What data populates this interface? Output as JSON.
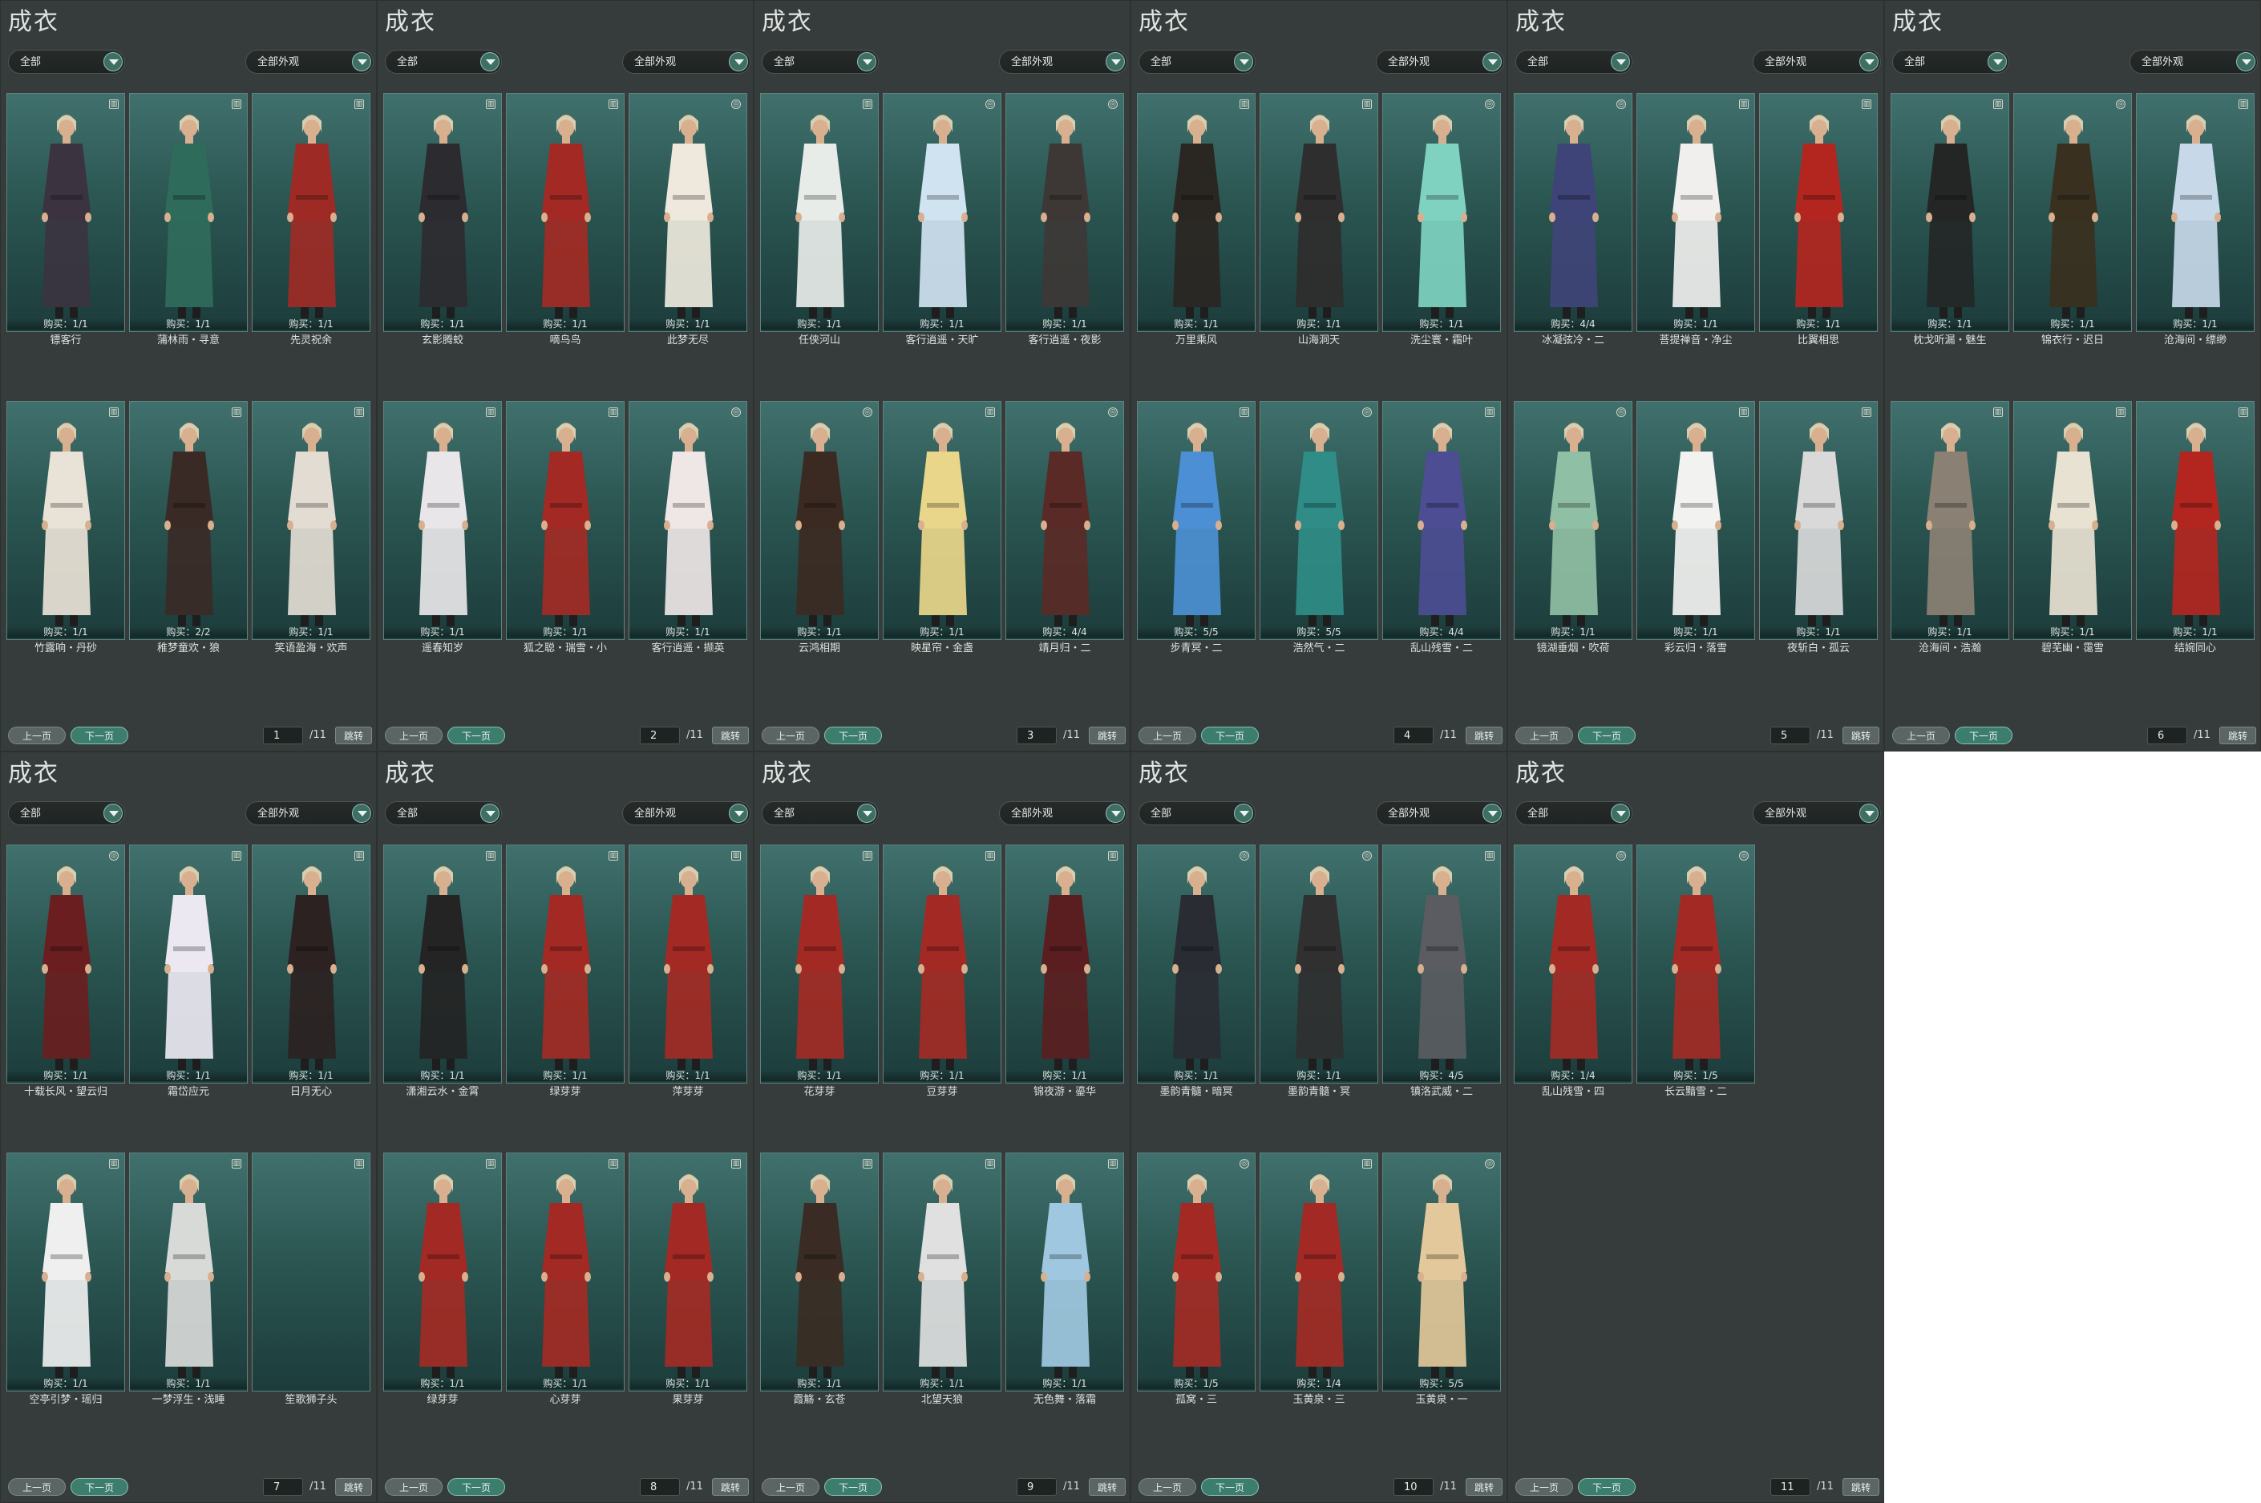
{
  "panel_title": "成衣",
  "filter_all": "全部",
  "filter_appearance": "全部外观",
  "prev_label": "上一页",
  "next_label": "下一页",
  "total_label": "/11",
  "jump_label": "跳转",
  "colors": {
    "panel_bg": "#363c3b",
    "card_bg": "#2b5652",
    "accent": "#3d7d6d"
  },
  "pages": [
    {
      "page_number": "1",
      "items": [
        {
          "name": "镖客行",
          "buy": "购买：1/1",
          "icon": "lock-icon",
          "outfit": "#3b3440"
        },
        {
          "name": "蒲林雨・寻意",
          "buy": "购买：1/1",
          "icon": "lock-icon",
          "outfit": "#2f6b5a"
        },
        {
          "name": "先灵祝余",
          "buy": "购买：1/1",
          "icon": "lock-icon",
          "outfit": "#9e2a25"
        },
        {
          "name": "竹露响・丹砂",
          "buy": "购买：1/1",
          "icon": "lock-icon",
          "outfit": "#e9e2d6"
        },
        {
          "name": "稚梦童欢・狼",
          "buy": "购买：2/2",
          "icon": "lock-icon",
          "outfit": "#3a2a26"
        },
        {
          "name": "笑语盈海・欢声",
          "buy": "购买：1/1",
          "icon": "lock-icon",
          "outfit": "#e3dcd3"
        }
      ]
    },
    {
      "page_number": "2",
      "items": [
        {
          "name": "玄影腾蛟",
          "buy": "购买：1/1",
          "icon": "lock-icon",
          "outfit": "#2c2b2f"
        },
        {
          "name": "嘀鸟鸟",
          "buy": "购买：1/1",
          "icon": "lock-icon",
          "outfit": "#a32a24"
        },
        {
          "name": "此梦无尽",
          "buy": "购买：1/1",
          "icon": "bag-icon",
          "outfit": "#eee9dc"
        },
        {
          "name": "遥春知岁",
          "buy": "购买：1/1",
          "icon": "lock-icon",
          "outfit": "#e8e6e8"
        },
        {
          "name": "狐之聪・瑞雪・小",
          "buy": "购买：1/1",
          "icon": "lock-icon",
          "outfit": "#a32a24"
        },
        {
          "name": "客行逍遥・撷英",
          "buy": "购买：1/1",
          "icon": "bag-icon",
          "outfit": "#efe6e6"
        }
      ]
    },
    {
      "page_number": "3",
      "items": [
        {
          "name": "任侠河山",
          "buy": "购买：1/1",
          "icon": "lock-icon",
          "outfit": "#e8ece8"
        },
        {
          "name": "客行逍遥・天旷",
          "buy": "购买：1/1",
          "icon": "bag-icon",
          "outfit": "#cfe3f0"
        },
        {
          "name": "客行逍遥・夜影",
          "buy": "购买：1/1",
          "icon": "bag-icon",
          "outfit": "#3d3836"
        },
        {
          "name": "云鸿相期",
          "buy": "购买：1/1",
          "icon": "bag-icon",
          "outfit": "#3b2a22"
        },
        {
          "name": "映星帘・金盏",
          "buy": "购买：1/1",
          "icon": "lock-icon",
          "outfit": "#e9d68a"
        },
        {
          "name": "靖月归・二",
          "buy": "购买：4/4",
          "icon": "bag-icon",
          "outfit": "#5a2a26"
        }
      ]
    },
    {
      "page_number": "4",
      "items": [
        {
          "name": "万里乘风",
          "buy": "购买：1/1",
          "icon": "lock-icon",
          "outfit": "#2a2622"
        },
        {
          "name": "山海洞天",
          "buy": "购买：1/1",
          "icon": "lock-icon",
          "outfit": "#2f2e2e"
        },
        {
          "name": "洗尘寰・霜叶",
          "buy": "购买：1/1",
          "icon": "bag-icon",
          "outfit": "#7fd2c0"
        },
        {
          "name": "步青冥・二",
          "buy": "购买：5/5",
          "icon": "lock-icon",
          "outfit": "#4c8fd4"
        },
        {
          "name": "浩然气・二",
          "buy": "购买：5/5",
          "icon": "bag-icon",
          "outfit": "#2f8c86"
        },
        {
          "name": "乱山残雪・二",
          "buy": "购买：4/4",
          "icon": "lock-icon",
          "outfit": "#4c4d93"
        }
      ]
    },
    {
      "page_number": "5",
      "items": [
        {
          "name": "冰凝弦冷・二",
          "buy": "购买：4/4",
          "icon": "bag-icon",
          "outfit": "#3f4478"
        },
        {
          "name": "菩提禅音・净尘",
          "buy": "购买：1/1",
          "icon": "lock-icon",
          "outfit": "#f0efee"
        },
        {
          "name": "比翼相思",
          "buy": "购买：1/1",
          "icon": "lock-icon",
          "outfit": "#b3261f"
        },
        {
          "name": "镜湖垂烟・吹荷",
          "buy": "购买：1/1",
          "icon": "bag-icon",
          "outfit": "#8fbfa4"
        },
        {
          "name": "彩云归・落雪",
          "buy": "购买：1/1",
          "icon": "lock-icon",
          "outfit": "#f2f2f0"
        },
        {
          "name": "夜斩白・孤云",
          "buy": "购买：1/1",
          "icon": "lock-icon",
          "outfit": "#d9d9d9"
        }
      ]
    },
    {
      "page_number": "6",
      "items": [
        {
          "name": "枕戈听漏・魅生",
          "buy": "购买：1/1",
          "icon": "lock-icon",
          "outfit": "#242626"
        },
        {
          "name": "锦衣行・迟日",
          "buy": "购买：1/1",
          "icon": "bag-icon",
          "outfit": "#3a3020"
        },
        {
          "name": "沧海间・缥缈",
          "buy": "购买：1/1",
          "icon": "lock-icon",
          "outfit": "#c7d8e8"
        },
        {
          "name": "沧海间・浩瀚",
          "buy": "购买：1/1",
          "icon": "lock-icon",
          "outfit": "#8a8074"
        },
        {
          "name": "碧芜幽・霭雪",
          "buy": "购买：1/1",
          "icon": "lock-icon",
          "outfit": "#e8e2d2"
        },
        {
          "name": "结婉同心",
          "buy": "购买：1/1",
          "icon": "lock-icon",
          "outfit": "#b3261f"
        }
      ]
    },
    {
      "page_number": "7",
      "items": [
        {
          "name": "十载长风・望云归",
          "buy": "购买：1/1",
          "icon": "bag-icon",
          "outfit": "#6a1e20"
        },
        {
          "name": "霜岱应元",
          "buy": "购买：1/1",
          "icon": "lock-icon",
          "outfit": "#ece8f2"
        },
        {
          "name": "日月无心",
          "buy": "购买：1/1",
          "icon": "lock-icon",
          "outfit": "#2c2222"
        },
        {
          "name": "空亭引梦・瑶归",
          "buy": "购买：1/1",
          "icon": "lock-icon",
          "outfit": "#efefef"
        },
        {
          "name": "一梦浮生・浅睡",
          "buy": "购买：1/1",
          "icon": "lock-icon",
          "outfit": "#d8dad8"
        },
        {
          "name": "笙歌狮子头",
          "buy": "",
          "icon": "lock-icon",
          "outfit": ""
        }
      ]
    },
    {
      "page_number": "8",
      "items": [
        {
          "name": "潇湘云水・金霄",
          "buy": "购买：1/1",
          "icon": "lock-icon",
          "outfit": "#242424"
        },
        {
          "name": "绿芽芽",
          "buy": "购买：1/1",
          "icon": "lock-icon",
          "outfit": "#a32a24"
        },
        {
          "name": "萍芽芽",
          "buy": "购买：1/1",
          "icon": "lock-icon",
          "outfit": "#a32a24"
        },
        {
          "name": "绿芽芽",
          "buy": "购买：1/1",
          "icon": "lock-icon",
          "outfit": "#a32a24"
        },
        {
          "name": "心芽芽",
          "buy": "购买：1/1",
          "icon": "lock-icon",
          "outfit": "#a32a24"
        },
        {
          "name": "果芽芽",
          "buy": "购买：1/1",
          "icon": "lock-icon",
          "outfit": "#a32a24"
        }
      ]
    },
    {
      "page_number": "9",
      "items": [
        {
          "name": "花芽芽",
          "buy": "购买：1/1",
          "icon": "lock-icon",
          "outfit": "#a32a24"
        },
        {
          "name": "豆芽芽",
          "buy": "购买：1/1",
          "icon": "lock-icon",
          "outfit": "#a32a24"
        },
        {
          "name": "锦夜游・鎏华",
          "buy": "购买：1/1",
          "icon": "lock-icon",
          "outfit": "#5a1e20"
        },
        {
          "name": "霞觞・玄苍",
          "buy": "购买：1/1",
          "icon": "lock-icon",
          "outfit": "#3a2c24"
        },
        {
          "name": "北望天狼",
          "buy": "购买：1/1",
          "icon": "lock-icon",
          "outfit": "#e0e0e0"
        },
        {
          "name": "无色舞・落霜",
          "buy": "购买：1/1",
          "icon": "lock-icon",
          "outfit": "#9fc8e0"
        }
      ]
    },
    {
      "page_number": "10",
      "items": [
        {
          "name": "墨韵青髓・暗冥",
          "buy": "购买：1/1",
          "icon": "bag-icon",
          "outfit": "#2a2c34"
        },
        {
          "name": "墨韵青髓・冥",
          "buy": "购买：1/1",
          "icon": "bag-icon",
          "outfit": "#303030"
        },
        {
          "name": "镇洛武威・二",
          "buy": "购买：4/5",
          "icon": "lock-icon",
          "outfit": "#5a5c62"
        },
        {
          "name": "孤窝・三",
          "buy": "购买：1/5",
          "icon": "bag-icon",
          "outfit": "#a32a24"
        },
        {
          "name": "玉黄泉・三",
          "buy": "购买：1/4",
          "icon": "lock-icon",
          "outfit": "#a32a24"
        },
        {
          "name": "玉黄泉・一",
          "buy": "购买：5/5",
          "icon": "bag-icon",
          "outfit": "#e2c89a"
        }
      ]
    },
    {
      "page_number": "11",
      "items": [
        {
          "name": "乱山残雪・四",
          "buy": "购买：1/4",
          "icon": "bag-icon",
          "outfit": "#a32a24"
        },
        {
          "name": "长云黯雪・二",
          "buy": "购买：1/5",
          "icon": "bag-icon",
          "outfit": "#a32a24"
        }
      ]
    }
  ]
}
